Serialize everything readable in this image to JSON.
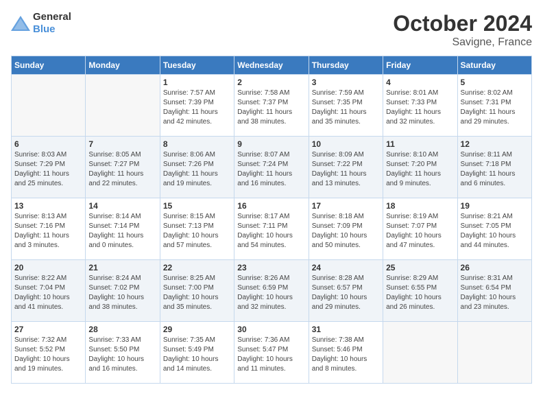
{
  "header": {
    "logo_general": "General",
    "logo_blue": "Blue",
    "month": "October 2024",
    "location": "Savigne, France"
  },
  "weekdays": [
    "Sunday",
    "Monday",
    "Tuesday",
    "Wednesday",
    "Thursday",
    "Friday",
    "Saturday"
  ],
  "weeks": [
    [
      {
        "day": "",
        "info": ""
      },
      {
        "day": "",
        "info": ""
      },
      {
        "day": "1",
        "info": "Sunrise: 7:57 AM\nSunset: 7:39 PM\nDaylight: 11 hours\nand 42 minutes."
      },
      {
        "day": "2",
        "info": "Sunrise: 7:58 AM\nSunset: 7:37 PM\nDaylight: 11 hours\nand 38 minutes."
      },
      {
        "day": "3",
        "info": "Sunrise: 7:59 AM\nSunset: 7:35 PM\nDaylight: 11 hours\nand 35 minutes."
      },
      {
        "day": "4",
        "info": "Sunrise: 8:01 AM\nSunset: 7:33 PM\nDaylight: 11 hours\nand 32 minutes."
      },
      {
        "day": "5",
        "info": "Sunrise: 8:02 AM\nSunset: 7:31 PM\nDaylight: 11 hours\nand 29 minutes."
      }
    ],
    [
      {
        "day": "6",
        "info": "Sunrise: 8:03 AM\nSunset: 7:29 PM\nDaylight: 11 hours\nand 25 minutes."
      },
      {
        "day": "7",
        "info": "Sunrise: 8:05 AM\nSunset: 7:27 PM\nDaylight: 11 hours\nand 22 minutes."
      },
      {
        "day": "8",
        "info": "Sunrise: 8:06 AM\nSunset: 7:26 PM\nDaylight: 11 hours\nand 19 minutes."
      },
      {
        "day": "9",
        "info": "Sunrise: 8:07 AM\nSunset: 7:24 PM\nDaylight: 11 hours\nand 16 minutes."
      },
      {
        "day": "10",
        "info": "Sunrise: 8:09 AM\nSunset: 7:22 PM\nDaylight: 11 hours\nand 13 minutes."
      },
      {
        "day": "11",
        "info": "Sunrise: 8:10 AM\nSunset: 7:20 PM\nDaylight: 11 hours\nand 9 minutes."
      },
      {
        "day": "12",
        "info": "Sunrise: 8:11 AM\nSunset: 7:18 PM\nDaylight: 11 hours\nand 6 minutes."
      }
    ],
    [
      {
        "day": "13",
        "info": "Sunrise: 8:13 AM\nSunset: 7:16 PM\nDaylight: 11 hours\nand 3 minutes."
      },
      {
        "day": "14",
        "info": "Sunrise: 8:14 AM\nSunset: 7:14 PM\nDaylight: 11 hours\nand 0 minutes."
      },
      {
        "day": "15",
        "info": "Sunrise: 8:15 AM\nSunset: 7:13 PM\nDaylight: 10 hours\nand 57 minutes."
      },
      {
        "day": "16",
        "info": "Sunrise: 8:17 AM\nSunset: 7:11 PM\nDaylight: 10 hours\nand 54 minutes."
      },
      {
        "day": "17",
        "info": "Sunrise: 8:18 AM\nSunset: 7:09 PM\nDaylight: 10 hours\nand 50 minutes."
      },
      {
        "day": "18",
        "info": "Sunrise: 8:19 AM\nSunset: 7:07 PM\nDaylight: 10 hours\nand 47 minutes."
      },
      {
        "day": "19",
        "info": "Sunrise: 8:21 AM\nSunset: 7:05 PM\nDaylight: 10 hours\nand 44 minutes."
      }
    ],
    [
      {
        "day": "20",
        "info": "Sunrise: 8:22 AM\nSunset: 7:04 PM\nDaylight: 10 hours\nand 41 minutes."
      },
      {
        "day": "21",
        "info": "Sunrise: 8:24 AM\nSunset: 7:02 PM\nDaylight: 10 hours\nand 38 minutes."
      },
      {
        "day": "22",
        "info": "Sunrise: 8:25 AM\nSunset: 7:00 PM\nDaylight: 10 hours\nand 35 minutes."
      },
      {
        "day": "23",
        "info": "Sunrise: 8:26 AM\nSunset: 6:59 PM\nDaylight: 10 hours\nand 32 minutes."
      },
      {
        "day": "24",
        "info": "Sunrise: 8:28 AM\nSunset: 6:57 PM\nDaylight: 10 hours\nand 29 minutes."
      },
      {
        "day": "25",
        "info": "Sunrise: 8:29 AM\nSunset: 6:55 PM\nDaylight: 10 hours\nand 26 minutes."
      },
      {
        "day": "26",
        "info": "Sunrise: 8:31 AM\nSunset: 6:54 PM\nDaylight: 10 hours\nand 23 minutes."
      }
    ],
    [
      {
        "day": "27",
        "info": "Sunrise: 7:32 AM\nSunset: 5:52 PM\nDaylight: 10 hours\nand 19 minutes."
      },
      {
        "day": "28",
        "info": "Sunrise: 7:33 AM\nSunset: 5:50 PM\nDaylight: 10 hours\nand 16 minutes."
      },
      {
        "day": "29",
        "info": "Sunrise: 7:35 AM\nSunset: 5:49 PM\nDaylight: 10 hours\nand 14 minutes."
      },
      {
        "day": "30",
        "info": "Sunrise: 7:36 AM\nSunset: 5:47 PM\nDaylight: 10 hours\nand 11 minutes."
      },
      {
        "day": "31",
        "info": "Sunrise: 7:38 AM\nSunset: 5:46 PM\nDaylight: 10 hours\nand 8 minutes."
      },
      {
        "day": "",
        "info": ""
      },
      {
        "day": "",
        "info": ""
      }
    ]
  ]
}
